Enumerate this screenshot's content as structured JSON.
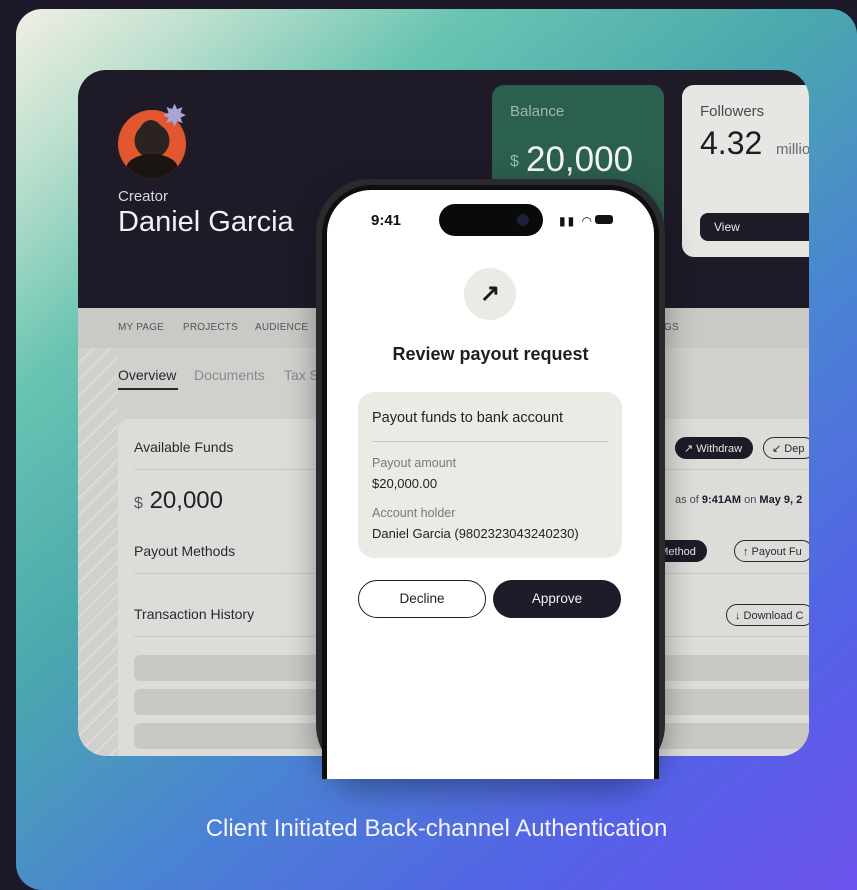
{
  "dashboard": {
    "creator_label": "Creator",
    "creator_name": "Daniel Garcia",
    "balance": {
      "label": "Balance",
      "currency": "$",
      "amount": "20,000"
    },
    "followers": {
      "label": "Followers",
      "value": "4.32",
      "unit": "million",
      "view_label": "View"
    },
    "nav": [
      "MY PAGE",
      "PROJECTS",
      "AUDIENCE",
      "GS"
    ],
    "tabs": [
      "Overview",
      "Documents",
      "Tax S"
    ],
    "panel": {
      "available_funds": "Available Funds",
      "currency": "$",
      "amount": "20,000",
      "payout_methods": "Payout Methods",
      "transaction_history": "Transaction History",
      "as_of_prefix": "as of",
      "as_of_time": "9:41AM",
      "as_of_on": "on",
      "as_of_date": "May 9, 2",
      "buttons": {
        "withdraw": "↗ Withdraw",
        "deposit": "↙ Dep",
        "payout_method": "ut Method",
        "payout_funds": "↑ Payout Fu",
        "download": "↓ Download C"
      }
    }
  },
  "phone": {
    "time": "9:41",
    "arrow_glyph": "↗",
    "title": "Review payout request",
    "request": {
      "heading": "Payout funds to bank account",
      "amount_label": "Payout amount",
      "amount_value": "$20,000.00",
      "holder_label": "Account holder",
      "holder_value": "Daniel Garcia (9802323043240230)"
    },
    "decline_label": "Decline",
    "approve_label": "Approve"
  },
  "caption": "Client Initiated Back-channel Authentication",
  "colors": {
    "approve_bg": "#201b29",
    "balance_card": "#2b5f4f",
    "dark_header": "#1f1a28"
  }
}
